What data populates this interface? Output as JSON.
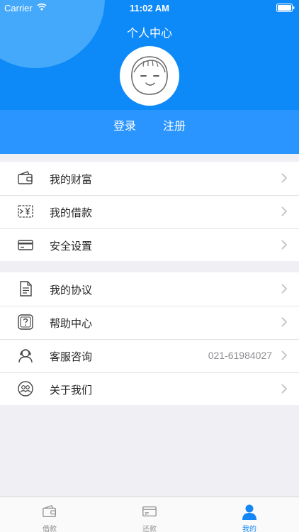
{
  "status_bar": {
    "carrier": "Carrier",
    "time": "11:02 AM"
  },
  "header": {
    "title": "个人中心",
    "login": "登录",
    "register": "注册"
  },
  "menu_group_1": [
    {
      "label": "我的财富",
      "icon": "wallet-icon"
    },
    {
      "label": "我的借款",
      "icon": "loan-yen-icon"
    },
    {
      "label": "安全设置",
      "icon": "card-icon"
    }
  ],
  "menu_group_2": [
    {
      "label": "我的协议",
      "icon": "document-icon"
    },
    {
      "label": "帮助中心",
      "icon": "help-icon"
    },
    {
      "label": "客服咨询",
      "icon": "customer-service-icon",
      "value": "021-61984027"
    },
    {
      "label": "关于我们",
      "icon": "about-us-icon"
    }
  ],
  "tabbar": [
    {
      "label": "借款",
      "icon": "wallet-icon",
      "active": false
    },
    {
      "label": "还款",
      "icon": "card-icon",
      "active": false
    },
    {
      "label": "我的",
      "icon": "person-icon",
      "active": true
    }
  ],
  "colors": {
    "primary": "#0e8af8",
    "header_lower": "#2b95ff",
    "accent": "#1486f5",
    "background": "#efeff4"
  }
}
